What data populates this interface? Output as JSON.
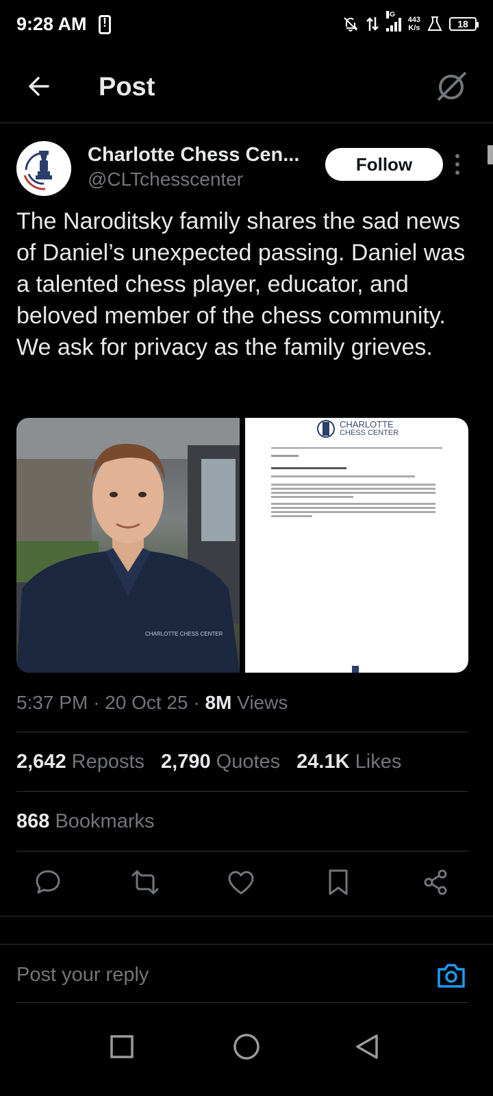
{
  "status_bar": {
    "time": "9:28 AM",
    "network_type": "4G",
    "speed_value": "443",
    "speed_unit": "K/s",
    "battery": "18"
  },
  "header": {
    "title": "Post"
  },
  "post": {
    "author_name": "Charlotte Chess Cen...",
    "author_handle": "@CLTchesscenter",
    "follow_label": "Follow",
    "text": "The Naroditsky family shares the sad news of Daniel’s unexpected passing. Daniel was a talented chess player, educator, and beloved member of the chess community. We ask for privacy as the family grieves.",
    "media": {
      "doc_logo_line1": "CHARLOTTE",
      "doc_logo_line2": "CHESS CENTER",
      "shirt_logo": "CHARLOTTE CHESS CENTER"
    },
    "time": "5:37 PM",
    "date": "20 Oct 25",
    "views_count": "8M",
    "views_label": "Views",
    "separator": "·",
    "reposts_count": "2,642",
    "reposts_label": "Reposts",
    "quotes_count": "2,790",
    "quotes_label": "Quotes",
    "likes_count": "24.1K",
    "likes_label": "Likes",
    "bookmarks_count": "868",
    "bookmarks_label": "Bookmarks"
  },
  "reply": {
    "placeholder": "Post your reply"
  },
  "colors": {
    "background": "#000000",
    "text": "#e7e9ea",
    "muted": "#71767b",
    "divider": "#2f3336",
    "accent": "#1d9bf0"
  },
  "icons": [
    "back-arrow-icon",
    "grok-icon",
    "more-vertical-icon",
    "reply-icon",
    "repost-icon",
    "like-icon",
    "bookmark-icon",
    "share-icon",
    "camera-icon",
    "nav-recents-icon",
    "nav-home-icon",
    "nav-back-icon"
  ]
}
